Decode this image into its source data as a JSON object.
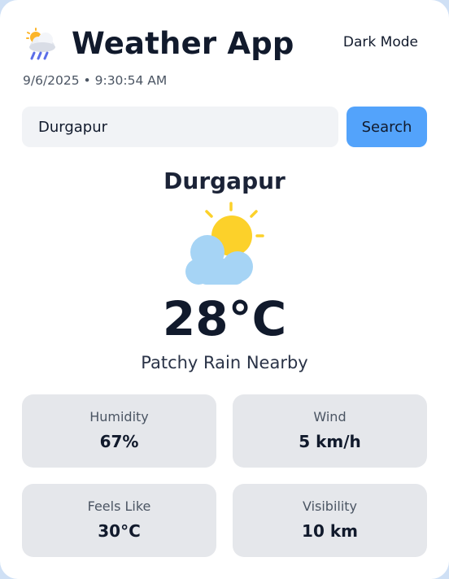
{
  "header": {
    "title": "Weather App",
    "app_icon": "sun-cloud-rain-icon",
    "dark_mode_label": "Dark Mode"
  },
  "datetime": "9/6/2025 • 9:30:54 AM",
  "search": {
    "value": "Durgapur",
    "button_label": "Search"
  },
  "current": {
    "city": "Durgapur",
    "icon": "sun-behind-cloud-icon",
    "temperature": "28°C",
    "condition": "Patchy Rain Nearby"
  },
  "stats": {
    "humidity": {
      "label": "Humidity",
      "value": "67%"
    },
    "wind": {
      "label": "Wind",
      "value": "5 km/h"
    },
    "feels_like": {
      "label": "Feels Like",
      "value": "30°C"
    },
    "visibility": {
      "label": "Visibility",
      "value": "10 km"
    }
  },
  "colors": {
    "accent": "#53a3fb",
    "sun": "#fcd12a",
    "cloud": "#a6d4f5",
    "card_bg": "#e5e7eb",
    "input_bg": "#f1f3f6",
    "page_bg": "#cfe0f5"
  }
}
